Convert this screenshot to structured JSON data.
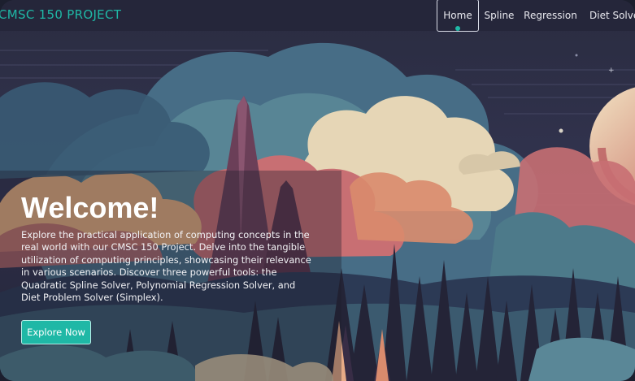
{
  "app": {
    "brand": "CMSC 150 PROJECT"
  },
  "nav": {
    "items": [
      {
        "label": "Home",
        "active": true
      },
      {
        "label": "Spline",
        "active": false
      },
      {
        "label": "Regression",
        "active": false
      },
      {
        "label": "Diet Solver",
        "active": false
      }
    ]
  },
  "hero": {
    "title": "Welcome!",
    "description": "Explore the practical application of computing concepts in the real world with our CMSC 150 Project. Delve into the tangible utilization of computing principles, showcasing their relevance in various scenarios. Discover three powerful tools: the Quadratic Spline Solver, Polynomial Regression Solver, and Diet Problem Solver (Simplex).",
    "cta_label": "Explore Now"
  },
  "colors": {
    "accent": "#1fb8a6",
    "nav_background": "#25263a",
    "text_light": "#ffffff"
  },
  "icons": {
    "active_indicator": "dot"
  }
}
